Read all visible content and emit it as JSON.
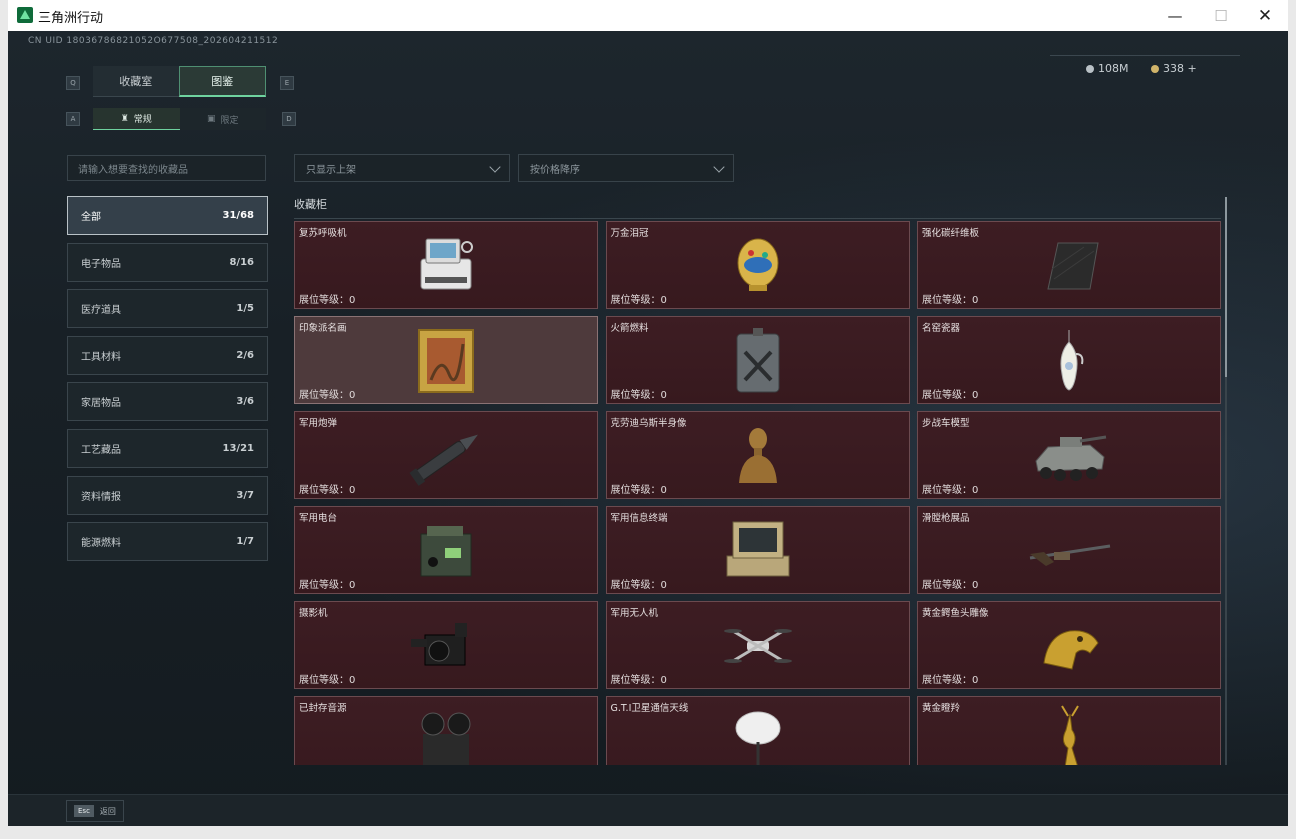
{
  "window": {
    "title": "三角洲行动",
    "min_icon": "—",
    "max_icon": "☐",
    "close_icon": "✕"
  },
  "uid": "CN UID 18036786821052O677508_202604211512",
  "currency": {
    "silver": "108M",
    "gold": "338 +"
  },
  "hotkeys": {
    "q": "Q",
    "e": "E",
    "a": "A",
    "d": "D"
  },
  "main_tabs": [
    {
      "label": "收藏室",
      "active": false
    },
    {
      "label": "图鉴",
      "active": true
    }
  ],
  "sub_tabs": [
    {
      "label": "常规",
      "icon": "collection-icon",
      "active": true
    },
    {
      "label": "限定",
      "icon": "limited-icon",
      "active": false
    }
  ],
  "search": {
    "placeholder": "请输入想要查找的收藏品"
  },
  "filters": {
    "shelf_filter": "只显示上架",
    "sort": "按价格降序"
  },
  "categories": [
    {
      "label": "全部",
      "count": "31/68",
      "active": true
    },
    {
      "label": "电子物品",
      "count": "8/16"
    },
    {
      "label": "医疗道具",
      "count": "1/5"
    },
    {
      "label": "工具材料",
      "count": "2/6"
    },
    {
      "label": "家居物品",
      "count": "3/6"
    },
    {
      "label": "工艺藏品",
      "count": "13/21"
    },
    {
      "label": "资料情报",
      "count": "3/7"
    },
    {
      "label": "能源燃料",
      "count": "1/7"
    }
  ],
  "section_title": "收藏柜",
  "level_label": "展位等级：",
  "items": [
    {
      "name": "复苏呼吸机",
      "level": "0",
      "icon": "ventilator-icon"
    },
    {
      "name": "万金泪冠",
      "level": "0",
      "icon": "jeweled-egg-icon"
    },
    {
      "name": "强化碳纤维板",
      "level": "0",
      "icon": "carbon-plate-icon"
    },
    {
      "name": "印象派名画",
      "level": "0",
      "icon": "painting-icon",
      "highlight": true
    },
    {
      "name": "火箭燃料",
      "level": "0",
      "icon": "fuel-can-icon"
    },
    {
      "name": "名窑瓷器",
      "level": "0",
      "icon": "porcelain-vase-icon"
    },
    {
      "name": "军用炮弹",
      "level": "0",
      "icon": "artillery-shell-icon"
    },
    {
      "name": "克劳迪乌斯半身像",
      "level": "0",
      "icon": "bust-icon"
    },
    {
      "name": "步战车模型",
      "level": "0",
      "icon": "ifv-model-icon"
    },
    {
      "name": "军用电台",
      "level": "0",
      "icon": "radio-icon"
    },
    {
      "name": "军用信息终端",
      "level": "0",
      "icon": "rugged-terminal-icon"
    },
    {
      "name": "滑膛枪展品",
      "level": "0",
      "icon": "musket-icon"
    },
    {
      "name": "摄影机",
      "level": "0",
      "icon": "camera-icon"
    },
    {
      "name": "军用无人机",
      "level": "0",
      "icon": "drone-icon"
    },
    {
      "name": "黄金鳄鱼头雕像",
      "level": "0",
      "icon": "gold-croc-icon"
    },
    {
      "name": "已封存音源",
      "level": "",
      "icon": "reel-recorder-icon"
    },
    {
      "name": "G.T.I卫星通信天线",
      "level": "",
      "icon": "satellite-dish-icon"
    },
    {
      "name": "黄金瞪羚",
      "level": "",
      "icon": "gold-gazelle-icon"
    }
  ],
  "bottom": {
    "esc_key": "Esc",
    "back_label": "返回"
  }
}
